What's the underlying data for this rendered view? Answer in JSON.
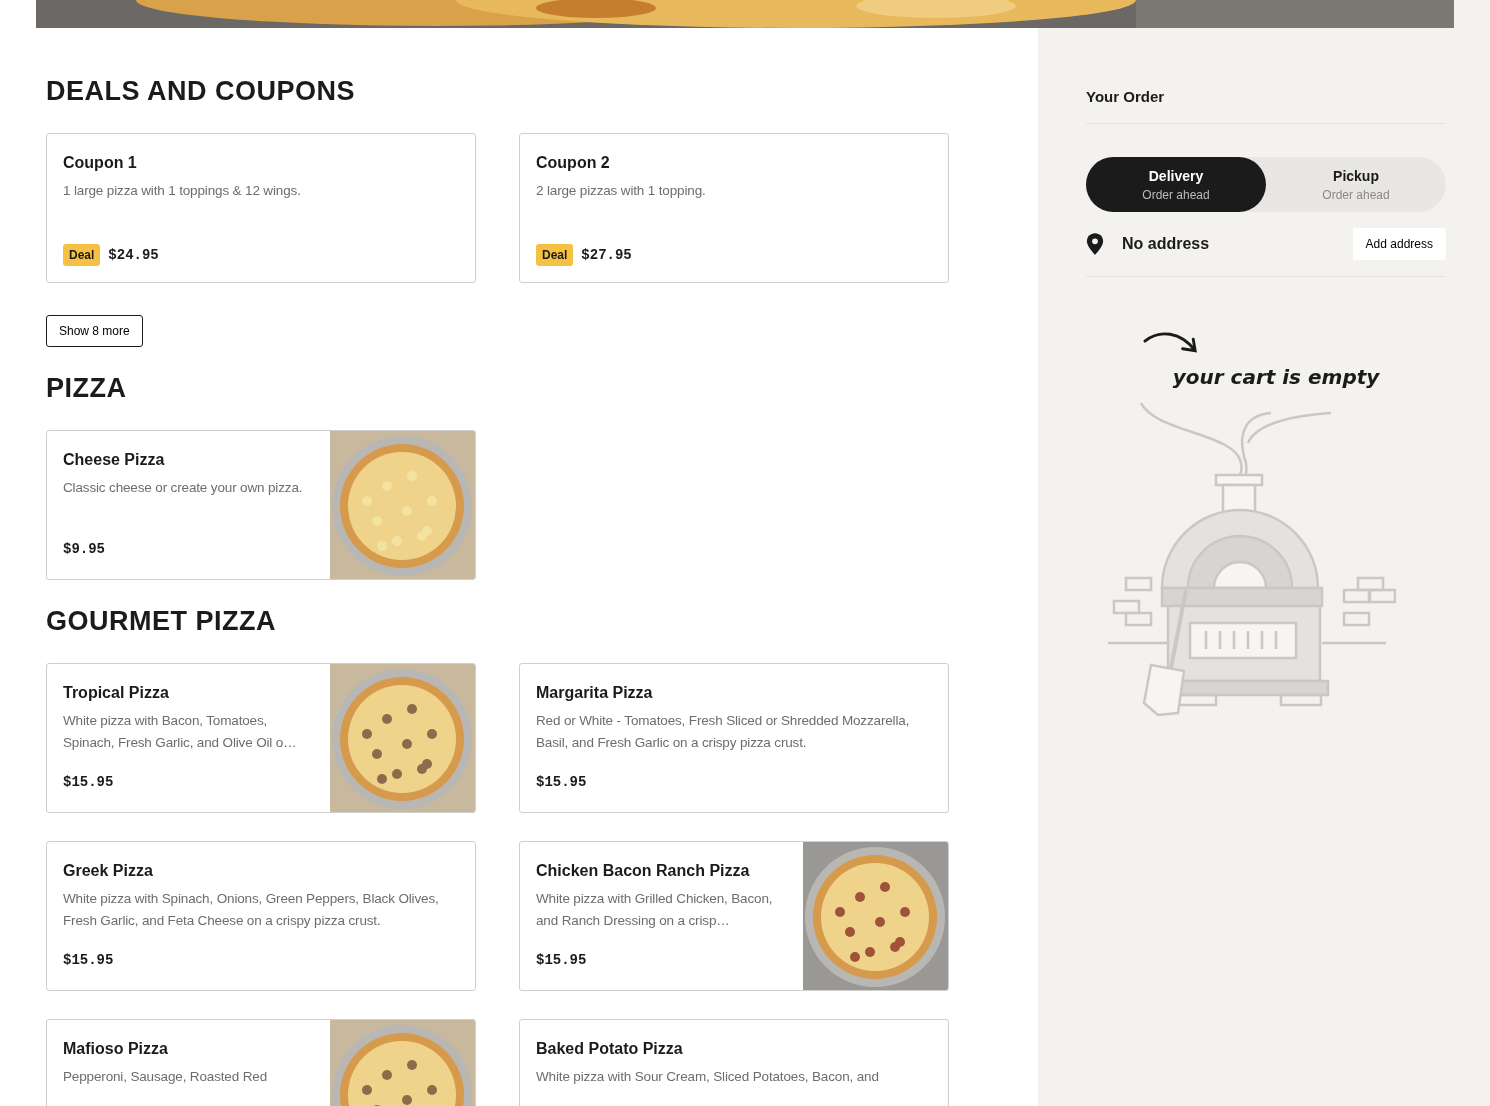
{
  "sections": [
    {
      "title": "DEALS AND COUPONS",
      "items": [
        {
          "name": "Coupon 1",
          "description": "1 large pizza with 1 toppings & 12 wings.",
          "badge": "Deal",
          "price": "$24.95",
          "has_image": false
        },
        {
          "name": "Coupon 2",
          "description": "2 large pizzas with 1 topping.",
          "badge": "Deal",
          "price": "$27.95",
          "has_image": false
        }
      ],
      "more_button": "Show 8 more"
    },
    {
      "title": "PIZZA",
      "items": [
        {
          "name": "Cheese Pizza",
          "description": "Classic cheese or create your own pizza.",
          "price": "$9.95",
          "has_image": true
        }
      ]
    },
    {
      "title": "GOURMET PIZZA",
      "items": [
        {
          "name": "Tropical Pizza",
          "description": "White pizza with Bacon, Tomatoes, Spinach, Fresh Garlic, and Olive Oil o…",
          "price": "$15.95",
          "has_image": true
        },
        {
          "name": "Margarita Pizza",
          "description": "Red or White - Tomatoes, Fresh Sliced or Shredded Mozzarella, Basil, and Fresh Garlic on a crispy pizza crust.",
          "price": "$15.95",
          "has_image": false
        },
        {
          "name": "Greek Pizza",
          "description": "White pizza with Spinach, Onions, Green Peppers, Black Olives, Fresh Garlic, and Feta Cheese on a crispy pizza crust.",
          "price": "$15.95",
          "has_image": false
        },
        {
          "name": "Chicken Bacon Ranch Pizza",
          "description": "White pizza with Grilled Chicken, Bacon, and Ranch Dressing on a crisp…",
          "price": "$15.95",
          "has_image": true
        },
        {
          "name": "Mafioso Pizza",
          "description": "Pepperoni, Sausage, Roasted Red",
          "has_image": true
        },
        {
          "name": "Baked Potato Pizza",
          "description": "White pizza with Sour Cream, Sliced Potatoes, Bacon, and",
          "has_image": false
        }
      ]
    }
  ],
  "order": {
    "title": "Your Order",
    "modes": [
      {
        "label": "Delivery",
        "sub": "Order ahead",
        "selected": true
      },
      {
        "label": "Pickup",
        "sub": "Order ahead",
        "selected": false
      }
    ],
    "address": "No address",
    "add_address_button": "Add address",
    "empty_text": "your cart is empty"
  }
}
